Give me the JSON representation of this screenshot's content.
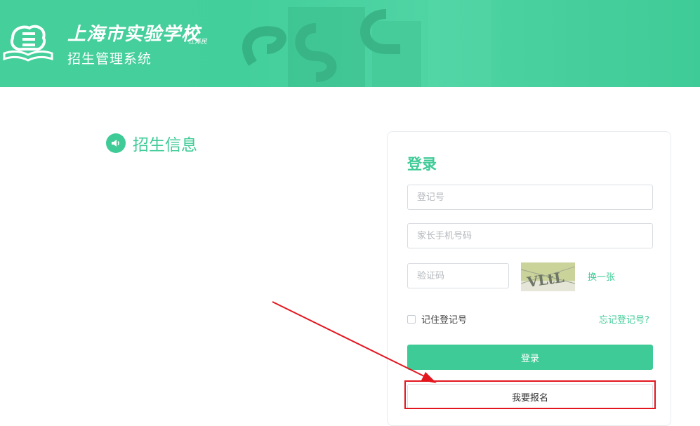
{
  "header": {
    "school_name": "上海市实验学校",
    "campus": "江泽民",
    "system_name": "招生管理系统",
    "logo_icon": "school-book-logo-icon"
  },
  "info_section": {
    "title": "招生信息",
    "icon": "speaker-icon"
  },
  "login": {
    "title": "登录",
    "registration_number": {
      "placeholder": "登记号",
      "value": ""
    },
    "parent_phone": {
      "placeholder": "家长手机号码",
      "value": ""
    },
    "verification_code": {
      "placeholder": "验证码",
      "value": ""
    },
    "captcha_text": "VLtL",
    "refresh_captcha_label": "换一张",
    "remember_label": "记住登记号",
    "forgot_label": "忘记登记号?",
    "login_button_label": "登录",
    "register_button_label": "我要报名"
  },
  "colors": {
    "brand": "#3fcb97",
    "annotation": "#e3161f"
  }
}
